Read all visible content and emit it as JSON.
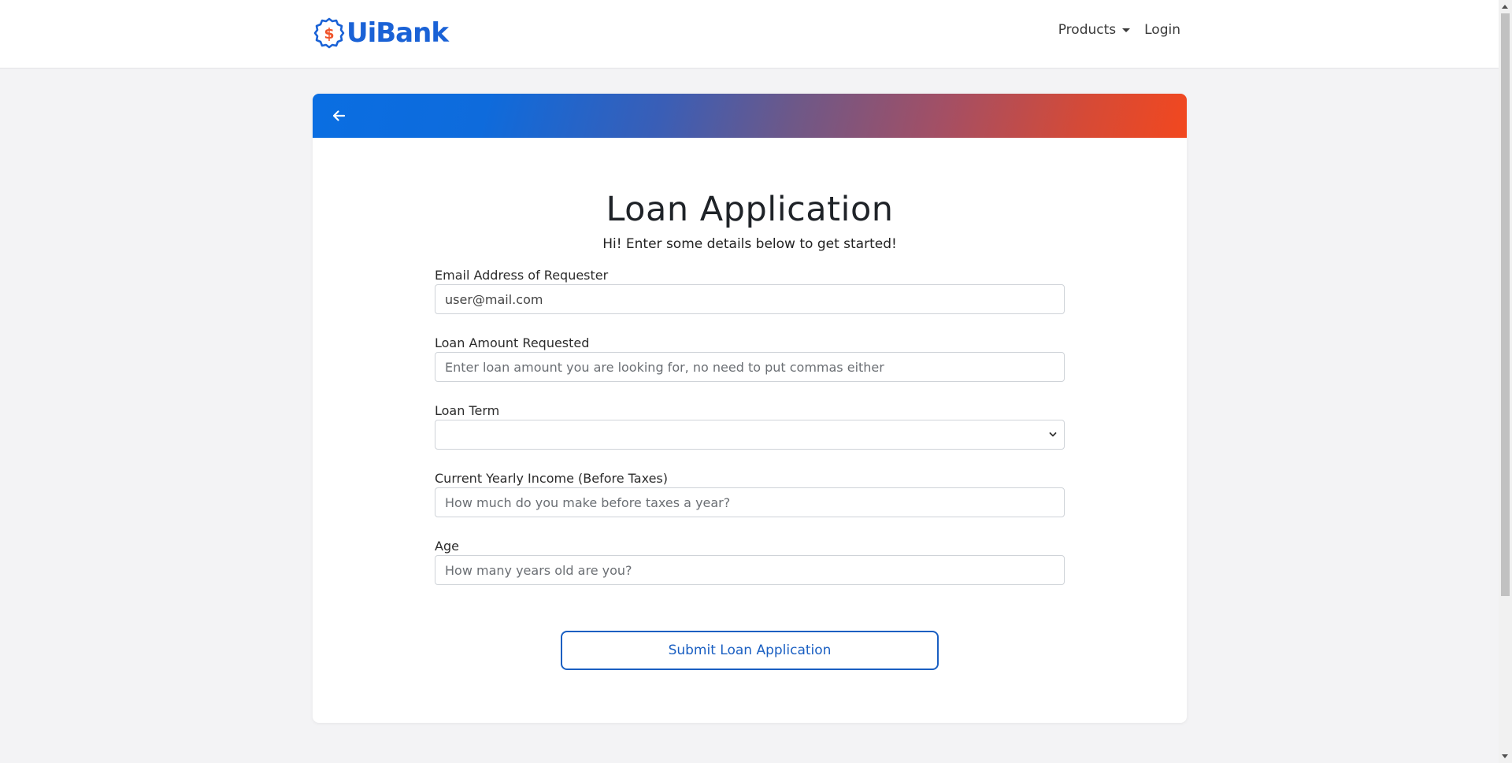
{
  "brand": {
    "name": "UiBank",
    "logo_icon": "dollar-gear-logo-icon",
    "logo_color": "#1a62d6",
    "accent_color": "#f0552b"
  },
  "nav": {
    "products_label": "Products",
    "login_label": "Login"
  },
  "card": {
    "header_gradient": [
      "#0a6ee2",
      "#f2481f"
    ],
    "back_icon": "arrow-left-icon",
    "title": "Loan Application",
    "subtitle": "Hi! Enter some details below to get started!"
  },
  "form": {
    "email": {
      "label": "Email Address of Requester",
      "value": "user@mail.com"
    },
    "amount": {
      "label": "Loan Amount Requested",
      "placeholder": "Enter loan amount you are looking for, no need to put commas either",
      "value": ""
    },
    "term": {
      "label": "Loan Term",
      "value": ""
    },
    "income": {
      "label": "Current Yearly Income (Before Taxes)",
      "placeholder": "How much do you make before taxes a year?",
      "value": ""
    },
    "age": {
      "label": "Age",
      "placeholder": "How many years old are you?",
      "value": ""
    },
    "submit_label": "Submit Loan Application",
    "submit_color": "#1a5fc2"
  }
}
